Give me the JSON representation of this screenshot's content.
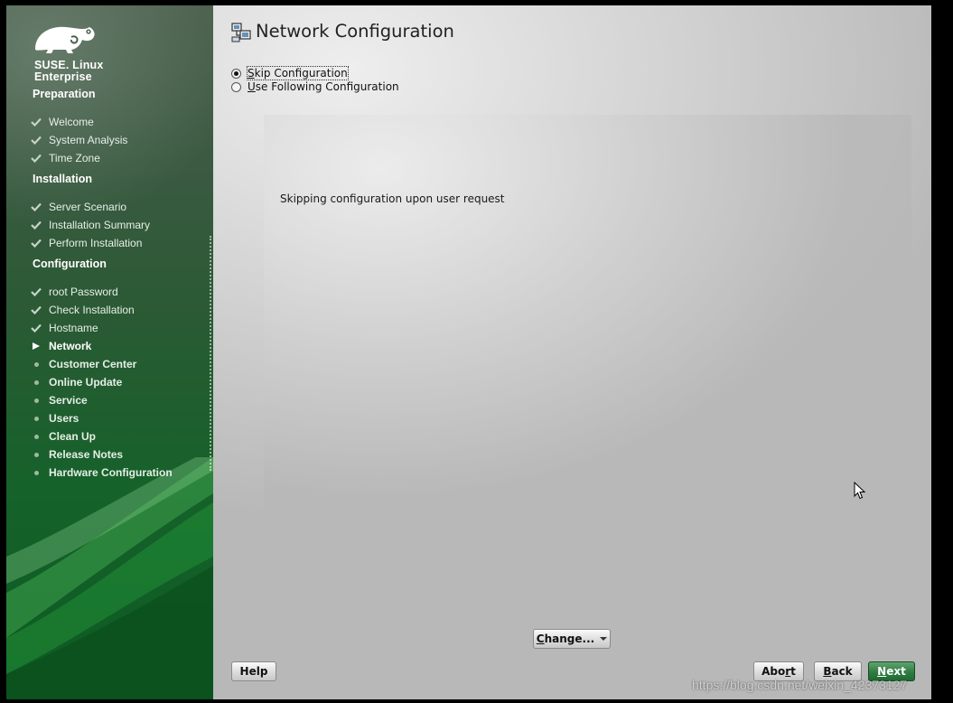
{
  "sidebar": {
    "logo_line1": "SUSE. Linux",
    "logo_line2": "Enterprise",
    "sections": [
      {
        "title": "Preparation",
        "steps": [
          {
            "label": "Welcome",
            "state": "done"
          },
          {
            "label": "System Analysis",
            "state": "done"
          },
          {
            "label": "Time Zone",
            "state": "done"
          }
        ]
      },
      {
        "title": "Installation",
        "steps": [
          {
            "label": "Server Scenario",
            "state": "done"
          },
          {
            "label": "Installation Summary",
            "state": "done"
          },
          {
            "label": "Perform Installation",
            "state": "done"
          }
        ]
      },
      {
        "title": "Configuration",
        "steps": [
          {
            "label": "root Password",
            "state": "done"
          },
          {
            "label": "Check Installation",
            "state": "done"
          },
          {
            "label": "Hostname",
            "state": "done"
          },
          {
            "label": "Network",
            "state": "current"
          },
          {
            "label": "Customer Center",
            "state": "pending"
          },
          {
            "label": "Online Update",
            "state": "pending"
          },
          {
            "label": "Service",
            "state": "pending"
          },
          {
            "label": "Users",
            "state": "pending"
          },
          {
            "label": "Clean Up",
            "state": "pending"
          },
          {
            "label": "Release Notes",
            "state": "pending"
          },
          {
            "label": "Hardware Configuration",
            "state": "pending"
          }
        ]
      }
    ]
  },
  "main": {
    "title": "Network Configuration",
    "title_icon": "network-config-icon",
    "options": {
      "skip": {
        "pre": "",
        "u": "S",
        "post": "kip Configuration",
        "selected": true
      },
      "use": {
        "pre": "",
        "u": "U",
        "post": "se Following Configuration",
        "selected": false
      }
    },
    "info_text": "Skipping configuration upon user request",
    "change": {
      "pre": "",
      "u": "C",
      "post": "hange..."
    }
  },
  "buttons": {
    "help": "Help",
    "abort": {
      "pre": "Abo",
      "u": "r",
      "post": "t"
    },
    "back": {
      "pre": "",
      "u": "B",
      "post": "ack"
    },
    "next": {
      "pre": "",
      "u": "N",
      "post": "ext"
    }
  },
  "watermark": "https://blog.csdn.net/weixin_42373127",
  "colors": {
    "sidebar_green": "#15622a",
    "next_button": "#2f7c42",
    "content_bg": "#d6d6d6"
  }
}
